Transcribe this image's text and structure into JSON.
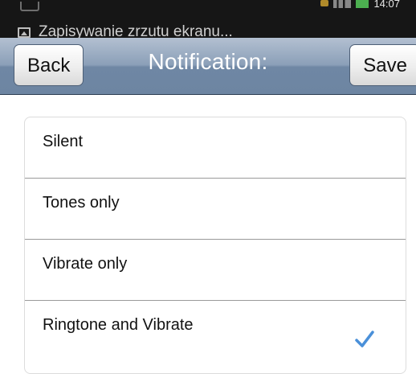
{
  "status_bar": {
    "notification_text": "Zapisywanie zrzutu ekranu...",
    "time": "14:07"
  },
  "nav": {
    "back_label": "Back",
    "title": "Notification:",
    "save_label": "Save"
  },
  "options": [
    {
      "label": "Silent",
      "selected": false
    },
    {
      "label": "Tones only",
      "selected": false
    },
    {
      "label": "Vibrate only",
      "selected": false
    },
    {
      "label": "Ringtone and Vibrate",
      "selected": true
    }
  ],
  "colors": {
    "nav_bar": "#8b9fb8",
    "check": "#4a90d9",
    "status_bar": "#161616"
  }
}
